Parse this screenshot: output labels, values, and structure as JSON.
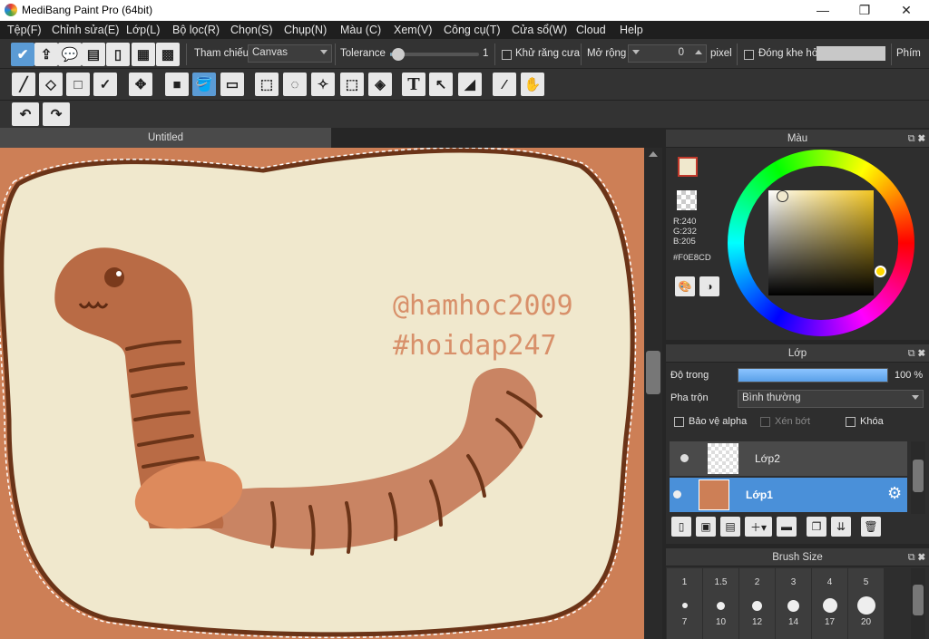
{
  "window": {
    "title": "MediBang Paint Pro (64bit)",
    "controls": [
      "—",
      "❐",
      "✕"
    ]
  },
  "menu": [
    "Tệp(F)",
    "Chỉnh sửa(E)",
    "Lớp(L)",
    "Bộ lọc(R)",
    "Chọn(S)",
    "Chụp(N)",
    "Màu (C)",
    "Xem(V)",
    "Công cụ(T)",
    "Cửa sổ(W)",
    "Cloud",
    "Help"
  ],
  "toolbar": {
    "reference_label": "Tham chiếu",
    "reference_value": "Canvas",
    "tolerance_label": "Tolerance",
    "tolerance_value": "1",
    "tolerance_level": 0.02,
    "antialias_label": "Khử răng cưa",
    "expand_label": "Mở rộng",
    "expand_value": "0",
    "expand_unit": "pixel",
    "close_gap_label": "Đóng khe hở",
    "keys_label": "Phím"
  },
  "document": {
    "tab_title": "Untitled"
  },
  "canvas_art": {
    "line1": "@hamhoc2009",
    "line2": "#hoidap247"
  },
  "color_panel": {
    "title": "Màu",
    "r": "R:240",
    "g": "G:232",
    "b": "B:205",
    "hex": "#F0E8CD",
    "fg_color": "#F0E8CD",
    "bg_color": "#FFF4CC"
  },
  "layers_panel": {
    "title": "Lớp",
    "opacity_label": "Độ trong",
    "opacity_value": "100 %",
    "opacity_level": 1.0,
    "blend_label": "Pha trộn",
    "blend_value": "Bình thường",
    "protect_alpha": "Bảo vệ alpha",
    "clipping": "Xén bớt",
    "lock": "Khóa",
    "layers": [
      {
        "name": "Lớp2",
        "selected": false
      },
      {
        "name": "Lớp1",
        "selected": true
      }
    ]
  },
  "brush_panel": {
    "title": "Brush Size",
    "row1": [
      "1",
      "1.5",
      "2",
      "3",
      "4",
      "5"
    ],
    "row2": [
      "7",
      "10",
      "12",
      "14",
      "17",
      "20"
    ]
  }
}
